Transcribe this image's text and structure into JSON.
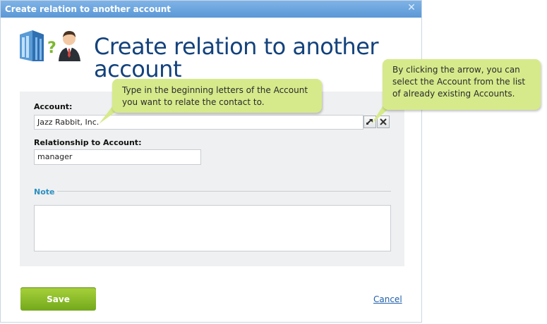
{
  "dialog": {
    "title": "Create relation to another account",
    "close_icon": "close-icon",
    "header_icon": "building-question-person-icon",
    "heading": "Create relation to another account"
  },
  "form": {
    "account_label": "Account:",
    "account_value": "Jazz Rabbit, Inc.",
    "select_icon": "select-arrow-icon",
    "clear_icon": "close-x-icon",
    "relationship_label": "Relationship to Account:",
    "relationship_value": "manager",
    "note_label": "Note",
    "note_value": ""
  },
  "actions": {
    "save_label": "Save",
    "cancel_label": "Cancel"
  },
  "tooltips": {
    "account_tip": "Type in the beginning letters of the Account you want to relate the contact to.",
    "arrow_tip": "By clicking the arrow, you can select the Account from the list of already existing Accounts."
  },
  "colors": {
    "titlebar": "#6aa5e0",
    "heading": "#13427c",
    "tooltip": "#d6ea8b",
    "save_button": "#8cbf2a",
    "note_label": "#2d8fc0",
    "link": "#1f5fa8"
  }
}
